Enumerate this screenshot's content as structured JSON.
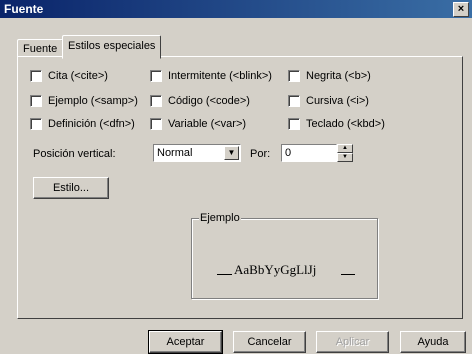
{
  "window": {
    "title": "Fuente",
    "close_glyph": "×"
  },
  "tabs": [
    {
      "label": "Fuente",
      "active": false
    },
    {
      "label": "Estilos especiales",
      "active": true
    }
  ],
  "checkboxes": [
    {
      "label": "Cita (<cite>)",
      "checked": false
    },
    {
      "label": "Intermitente (<blink>)",
      "checked": false
    },
    {
      "label": "Negrita (<b>)",
      "checked": false
    },
    {
      "label": "Ejemplo (<samp>)",
      "checked": false
    },
    {
      "label": "Código (<code>)",
      "checked": false
    },
    {
      "label": "Cursiva (<i>)",
      "checked": false
    },
    {
      "label": "Definición (<dfn>)",
      "checked": false
    },
    {
      "label": "Variable (<var>)",
      "checked": false
    },
    {
      "label": "Teclado (<kbd>)",
      "checked": false
    }
  ],
  "position": {
    "label": "Posición vertical:",
    "selected": "Normal",
    "por_label": "Por:",
    "por_value": "0"
  },
  "buttons": {
    "estilo": "Estilo...",
    "aceptar": "Aceptar",
    "cancelar": "Cancelar",
    "aplicar": "Aplicar",
    "ayuda": "Ayuda"
  },
  "example": {
    "label": "Ejemplo",
    "sample_text": "AaBbYyGgLlJj"
  }
}
